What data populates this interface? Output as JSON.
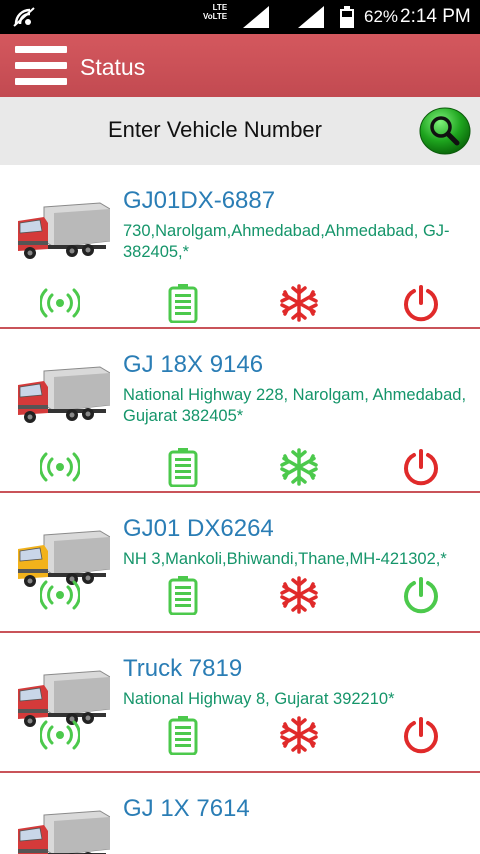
{
  "status_bar": {
    "network_type": "LTE",
    "volte": "VoLTE",
    "battery_percent": "62%",
    "time": "2:14 PM"
  },
  "app_bar": {
    "title": "Status"
  },
  "search": {
    "placeholder": "Enter Vehicle Number"
  },
  "colors": {
    "on": "#4cc94c",
    "off": "#e02a2a",
    "name": "#2a7db5",
    "address": "#15956a",
    "brand": "#c95359"
  },
  "vehicles": [
    {
      "name": "GJ01DX-6887",
      "address": "730,Narolgam,Ahmedabad,Ahmedabad, GJ-382405,*",
      "truck_color": "red",
      "gps": "on",
      "battery": "on",
      "ac": "off",
      "power": "off"
    },
    {
      "name": "GJ 18X 9146",
      "address": "National Highway 228, Narolgam, Ahmedabad, Gujarat 382405*",
      "truck_color": "red",
      "gps": "on",
      "battery": "on",
      "ac": "on",
      "power": "off"
    },
    {
      "name": "GJ01 DX6264",
      "address": "NH 3,Mankoli,Bhiwandi,Thane,MH-421302,*",
      "truck_color": "yellow",
      "gps": "on",
      "battery": "on",
      "ac": "off",
      "power": "on"
    },
    {
      "name": "Truck 7819",
      "address": "National Highway 8, Gujarat 392210*",
      "truck_color": "red",
      "gps": "on",
      "battery": "on",
      "ac": "off",
      "power": "off"
    },
    {
      "name": "GJ 1X 7614",
      "address": "",
      "truck_color": "red",
      "gps": "",
      "battery": "",
      "ac": "",
      "power": ""
    }
  ],
  "icons": {
    "menu": "hamburger-icon",
    "search": "magnifier-icon",
    "gps": "signal-broadcast-icon",
    "battery": "battery-icon",
    "ac": "snowflake-icon",
    "power": "power-icon",
    "truck": "truck-icon"
  }
}
